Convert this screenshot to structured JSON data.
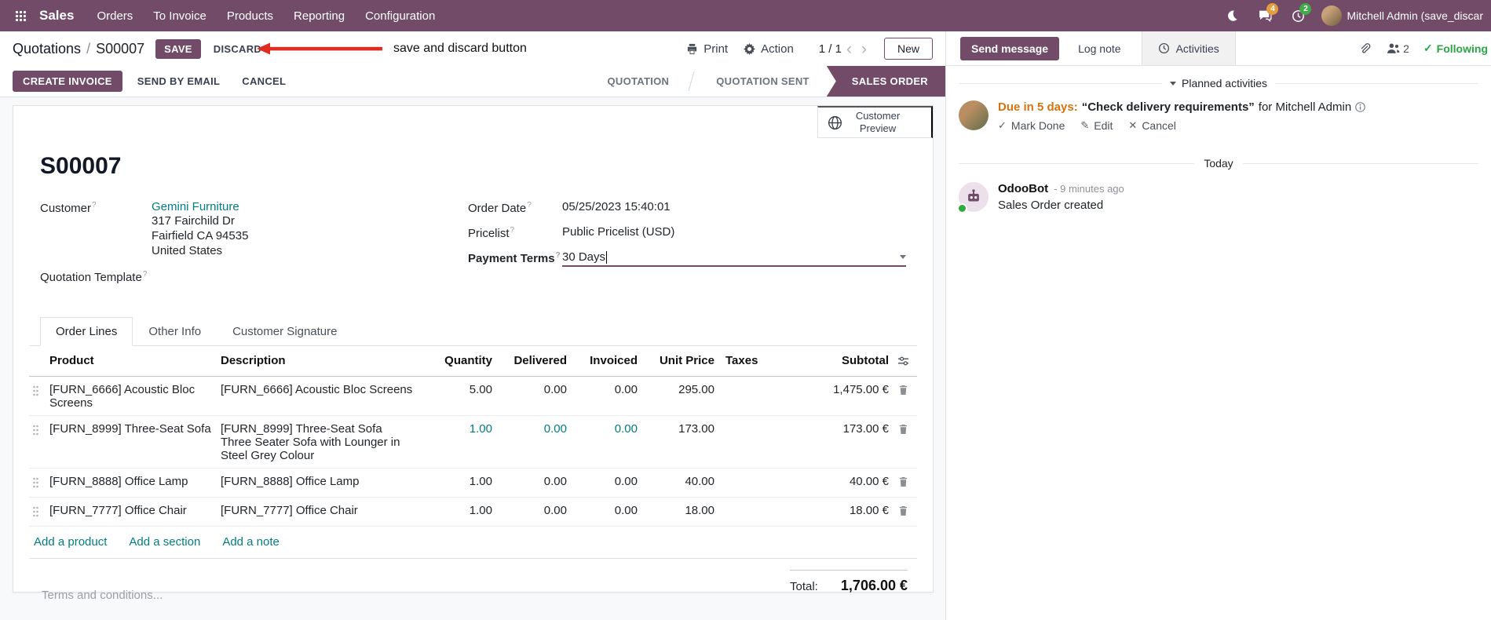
{
  "navbar": {
    "brand": "Sales",
    "menus": [
      "Orders",
      "To Invoice",
      "Products",
      "Reporting",
      "Configuration"
    ],
    "chat_badge": "4",
    "clock_badge": "2",
    "user_name": "Mitchell Admin (save_discar"
  },
  "control_panel": {
    "breadcrumb_parent": "Quotations",
    "breadcrumb_separator": "/",
    "breadcrumb_current": "S00007",
    "save_label": "SAVE",
    "discard_label": "DISCARD",
    "print_label": "Print",
    "action_label": "Action",
    "pager_value": "1 / 1",
    "new_label": "New"
  },
  "annotation": {
    "label": "save and discard button"
  },
  "statusbar": {
    "create_invoice": "CREATE INVOICE",
    "send_by_email": "SEND BY EMAIL",
    "cancel": "CANCEL",
    "states": [
      "QUOTATION",
      "QUOTATION SENT",
      "SALES ORDER"
    ],
    "active_state": "SALES ORDER"
  },
  "form": {
    "customer_preview": "Customer Preview",
    "title": "S00007",
    "hint": "?",
    "customer": {
      "label": "Customer",
      "name": "Gemini Furniture",
      "address": [
        "317 Fairchild Dr",
        "Fairfield CA 94535",
        "United States"
      ]
    },
    "quotation_template_label": "Quotation Template",
    "order_date": {
      "label": "Order Date",
      "value": "05/25/2023 15:40:01"
    },
    "pricelist": {
      "label": "Pricelist",
      "value": "Public Pricelist (USD)"
    },
    "payment_terms": {
      "label": "Payment Terms",
      "value": "30 Days"
    },
    "tabs": [
      "Order Lines",
      "Other Info",
      "Customer Signature"
    ],
    "table": {
      "headers": [
        "Product",
        "Description",
        "Quantity",
        "Delivered",
        "Invoiced",
        "Unit Price",
        "Taxes",
        "Subtotal"
      ],
      "rows": [
        {
          "product": "[FURN_6666] Acoustic Bloc Screens",
          "description": "[FURN_6666] Acoustic Bloc Screens",
          "description2": "",
          "quantity": "5.00",
          "delivered": "0.00",
          "invoiced": "0.00",
          "unit_price": "295.00",
          "taxes": "",
          "subtotal": "1,475.00 €"
        },
        {
          "product": "[FURN_8999] Three-Seat Sofa",
          "description": "[FURN_8999] Three-Seat Sofa",
          "description2": "Three Seater Sofa with Lounger in Steel Grey Colour",
          "quantity": "1.00",
          "delivered": "0.00",
          "invoiced": "0.00",
          "unit_price": "173.00",
          "taxes": "",
          "subtotal": "173.00 €"
        },
        {
          "product": "[FURN_8888] Office Lamp",
          "description": "[FURN_8888] Office Lamp",
          "description2": "",
          "quantity": "1.00",
          "delivered": "0.00",
          "invoiced": "0.00",
          "unit_price": "40.00",
          "taxes": "",
          "subtotal": "40.00 €"
        },
        {
          "product": "[FURN_7777] Office Chair",
          "description": "[FURN_7777] Office Chair",
          "description2": "",
          "quantity": "1.00",
          "delivered": "0.00",
          "invoiced": "0.00",
          "unit_price": "18.00",
          "taxes": "",
          "subtotal": "18.00 €"
        }
      ],
      "add_product": "Add a product",
      "add_section": "Add a section",
      "add_note": "Add a note"
    },
    "terms_placeholder": "Terms and conditions...",
    "total_label": "Total:",
    "total_value": "1,706.00 €"
  },
  "chatter": {
    "send_message": "Send message",
    "log_note": "Log note",
    "activities": "Activities",
    "followers_count": "2",
    "following_label": "Following",
    "planned_activities_header": "Planned activities",
    "activity": {
      "due": "Due in 5 days:",
      "summary": "“Check delivery requirements”",
      "assignee": "for Mitchell Admin",
      "mark_done": "Mark Done",
      "edit": "Edit",
      "cancel": "Cancel"
    },
    "date_divider": "Today",
    "message": {
      "author": "OdooBot",
      "timestamp": "- 9 minutes ago",
      "body": "Sales Order created"
    }
  },
  "icons": {
    "check": "✓",
    "pencil": "✎",
    "close": "✕",
    "prev": "‹",
    "next": "›"
  },
  "colors": {
    "primary": "#714B67",
    "link_teal": "#017e84",
    "due_warning": "#d9730d",
    "following_green": "#28a745",
    "annotation_red": "#e02b20"
  }
}
